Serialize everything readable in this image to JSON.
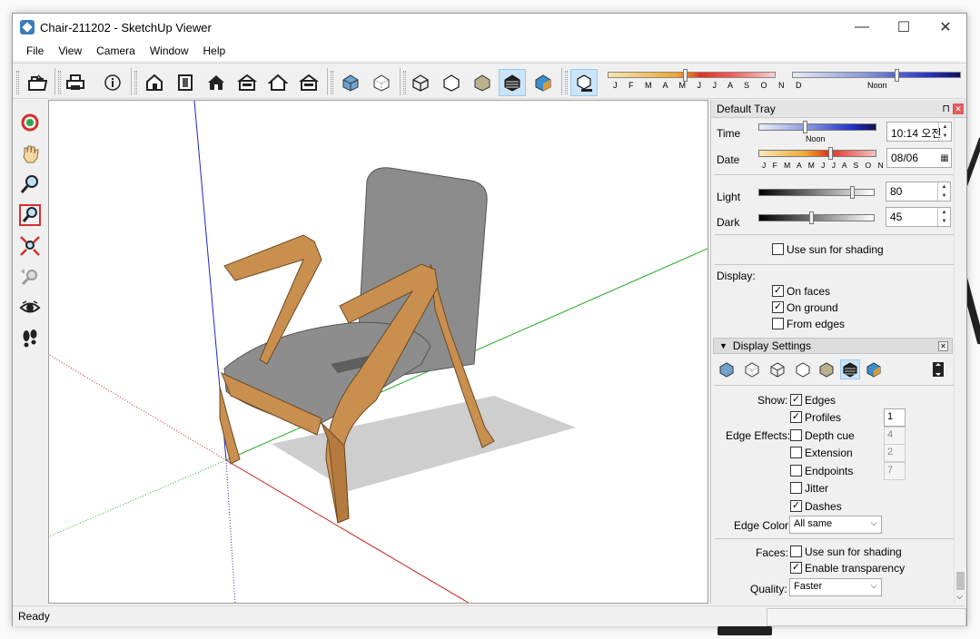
{
  "window": {
    "title": "Chair-211202 - SketchUp Viewer",
    "min": "—",
    "max": "☐",
    "close": "✕"
  },
  "menu": [
    "File",
    "View",
    "Camera",
    "Window",
    "Help"
  ],
  "toolbar": {
    "months": "J F M A M J J A S O N D",
    "noon": "Noon"
  },
  "tray": {
    "title": "Default Tray",
    "pin": "⊓",
    "close": "✕",
    "time": {
      "label": "Time",
      "value": "10:14 오전",
      "noon": "Noon"
    },
    "date": {
      "label": "Date",
      "value": "08/06",
      "months": "J F M A M J J A S O N D"
    },
    "light": {
      "label": "Light",
      "value": "80"
    },
    "dark": {
      "label": "Dark",
      "value": "45"
    },
    "use_sun": {
      "label": "Use sun for shading",
      "checked": false
    },
    "display": {
      "label": "Display:",
      "on_faces": {
        "label": "On faces",
        "checked": true
      },
      "on_ground": {
        "label": "On ground",
        "checked": true
      },
      "from_edges": {
        "label": "From edges",
        "checked": false
      }
    },
    "display_settings": {
      "title": "Display Settings",
      "show_label": "Show:",
      "edges": {
        "label": "Edges",
        "checked": true
      },
      "profiles": {
        "label": "Profiles",
        "checked": true,
        "value": "1"
      },
      "edge_effects_label": "Edge Effects:",
      "depth_cue": {
        "label": "Depth cue",
        "checked": false,
        "value": "4"
      },
      "extension": {
        "label": "Extension",
        "checked": false,
        "value": "2"
      },
      "endpoints": {
        "label": "Endpoints",
        "checked": false,
        "value": "7"
      },
      "jitter": {
        "label": "Jitter",
        "checked": false
      },
      "dashes": {
        "label": "Dashes",
        "checked": true
      },
      "edge_color_label": "Edge Color:",
      "edge_color_value": "All same",
      "faces_label": "Faces:",
      "faces_use_sun": {
        "label": "Use sun for shading",
        "checked": false
      },
      "faces_transparency": {
        "label": "Enable transparency",
        "checked": true
      },
      "quality_label": "Quality:",
      "quality_value": "Faster"
    }
  },
  "status": {
    "text": "Ready"
  },
  "colors": {
    "accent": "#3a7bbf",
    "active_bg": "#cce4f7",
    "axis_red": "#cc2222",
    "axis_green": "#22aa22",
    "axis_blue": "#2222cc",
    "wood": "#c98f4f",
    "fabric": "#808080"
  }
}
